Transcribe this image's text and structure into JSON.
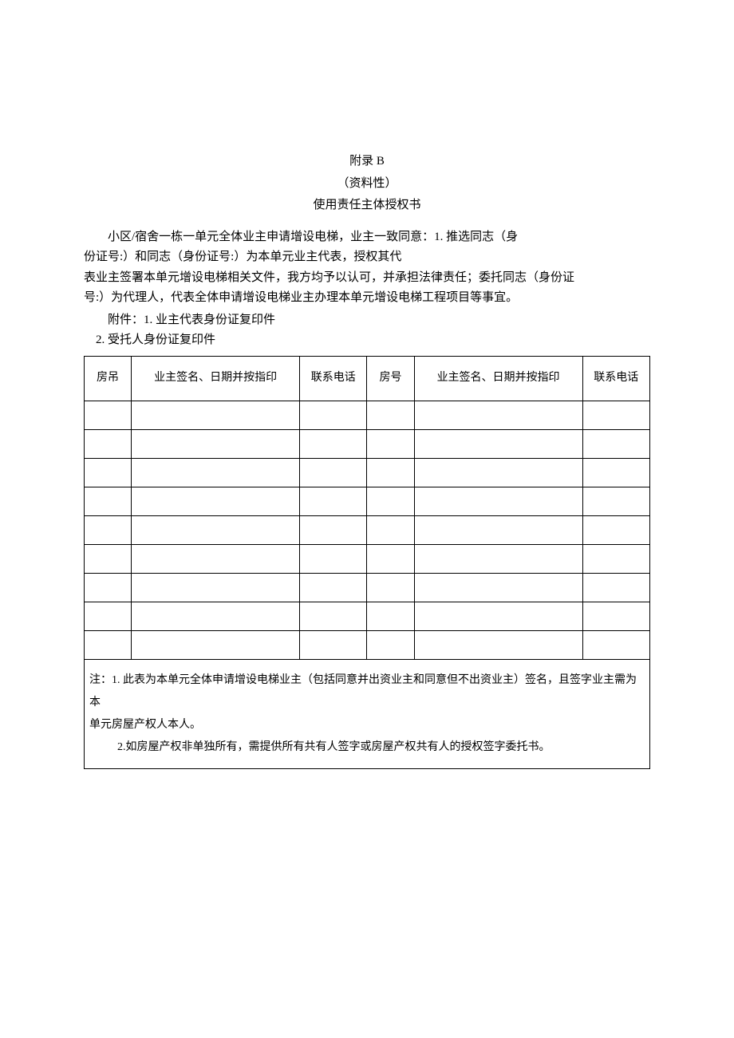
{
  "header": {
    "appendix": "附录 B",
    "nature": "（资料性）",
    "title": "使用责任主体授权书"
  },
  "body": {
    "p1": "小区/宿舍一栋一单元全体业主申请增设电梯，业主一致同意：1. 推选同志（身",
    "p2": "份证号:）和同志（身份证号:）为本单元业主代表，授权其代",
    "p3": "表业主签署本单元增设电梯相关文件，我方均予以认可，并承担法律责任；委托同志（身份证",
    "p4": "号:）为代理人，代表全体申请增设电梯业主办理本单元增设电梯工程项目等事宜。"
  },
  "attachments": {
    "label": "附件：1. 业主代表身份证复印件",
    "item2": "2. 受托人身份证复印件"
  },
  "table": {
    "h": {
      "room1": "房吊",
      "sign1": "业主签名、日期并按指印",
      "phone1": "联系电话",
      "room2": "房号",
      "sign2": "业主签名、日期并按指印",
      "phone2": "联系电话"
    }
  },
  "notes": {
    "n1": "注：1. 此表为本单元全体申请增设电梯业主（包括同意并出资业主和同意但不出资业主）签名，且签字业主需为本",
    "n1b": "单元房屋产权人本人。",
    "n2": "2.如房屋产权非单独所有，需提供所有共有人签字或房屋产权共有人的授权签字委托书。"
  }
}
